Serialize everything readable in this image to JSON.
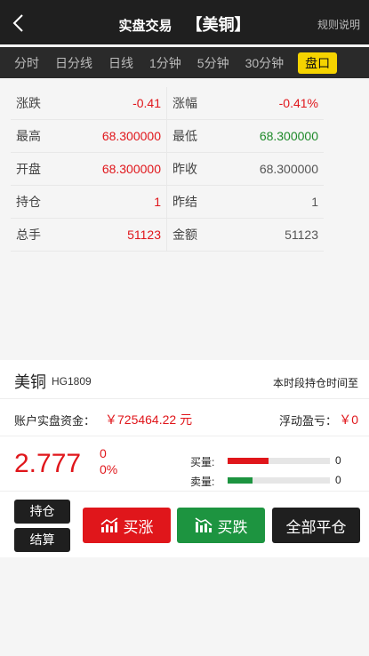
{
  "header": {
    "title": "实盘交易",
    "product_name": "【美铜】",
    "rules_link": "规则说明"
  },
  "tabs": [
    {
      "label": "分时",
      "active": false
    },
    {
      "label": "日分线",
      "active": false
    },
    {
      "label": "日线",
      "active": false
    },
    {
      "label": "1分钟",
      "active": false
    },
    {
      "label": "5分钟",
      "active": false
    },
    {
      "label": "30分钟",
      "active": false
    },
    {
      "label": "盘口",
      "active": true
    }
  ],
  "stats": [
    {
      "left_label": "涨跌",
      "left_value": "-0.41",
      "right_label": "涨幅",
      "right_value": "-0.41%"
    },
    {
      "left_label": "最高",
      "left_value": "68.300000",
      "right_label": "最低",
      "right_value": "68.300000"
    },
    {
      "left_label": "开盘",
      "left_value": "68.300000",
      "right_label": "昨收",
      "right_value": "68.300000"
    },
    {
      "left_label": "持仓",
      "left_value": "1",
      "right_label": "昨结",
      "right_value": "1"
    },
    {
      "left_label": "总手",
      "left_value": "51123",
      "right_label": "金额",
      "right_value": "51123"
    }
  ],
  "product": {
    "name": "美铜",
    "code": "HG1809",
    "hint": "本时段持仓时间至"
  },
  "account": {
    "funds_label": "账户实盘资金：",
    "funds_value": "￥725464.22 元",
    "pnl_label": "浮动盈亏：",
    "pnl_value": "￥0"
  },
  "quote": {
    "price": "2.777",
    "change": "0",
    "change_pct": "0%",
    "buy_volume_label": "买量:",
    "buy_volume": "0",
    "buy_level": 0.4,
    "sell_volume_label": "卖量:",
    "sell_volume": "0",
    "sell_level": 0.24
  },
  "actions": {
    "position_button": "持仓",
    "settle_button": "结算",
    "buy_up_button": "买涨",
    "buy_down_button": "买跌",
    "close_all_button": "全部平仓"
  },
  "colors": {
    "up": "#e0161b",
    "down": "#1d9440",
    "active_tab": "#f5d300",
    "dark": "#1f1f1f"
  }
}
